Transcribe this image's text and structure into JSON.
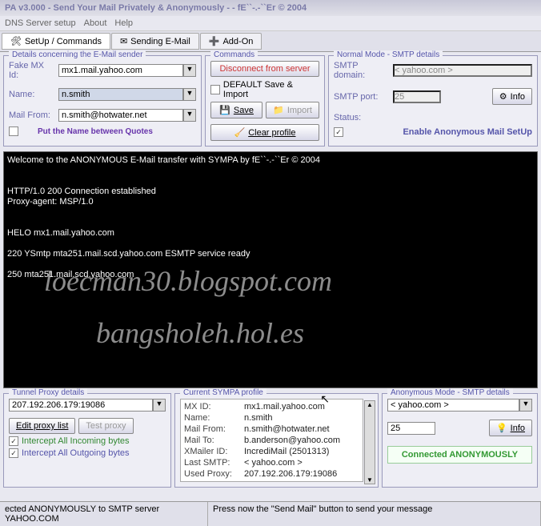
{
  "title": "PA v3.000 - Send Your Mail Privately & Anonymously -                    - fE``-.-``Er © 2004",
  "menu": {
    "dns": "DNS Server setup",
    "about": "About",
    "help": "Help"
  },
  "tabs": {
    "setup": "SetUp / Commands",
    "sending": "Sending E-Mail",
    "addon": "Add-On"
  },
  "sender": {
    "title": "Details concerning the E-Mail sender",
    "fakemx_lbl": "Fake MX  Id:",
    "fakemx": "mx1.mail.yahoo.com",
    "name_lbl": "Name:",
    "name": "n.smith",
    "from_lbl": "Mail From:",
    "from": "n.smith@hotwater.net",
    "quote": "Put the Name between Quotes"
  },
  "commands": {
    "title": "Commands",
    "disconnect": "Disconnect from server",
    "default": "DEFAULT Save & Import",
    "save": "Save",
    "import": "Import",
    "clear": "Clear profile"
  },
  "smtp": {
    "title": "Normal Mode - SMTP details",
    "domain_lbl": "SMTP domain:",
    "domain": "< yahoo.com >",
    "port_lbl": "SMTP port:",
    "port": "25",
    "info": "Info",
    "status_lbl": "Status:",
    "enable": "Enable Anonymous Mail  SetUp"
  },
  "console": [
    "Welcome to the ANONYMOUS E-Mail transfer with SYMPA  by fE``-.-``Er © 2004",
    "",
    "",
    "HTTP/1.0 200 Connection established",
    "Proxy-agent: MSP/1.0",
    "",
    "",
    "HELO mx1.mail.yahoo.com",
    "",
    "220 YSmtp mta251.mail.scd.yahoo.com ESMTP service ready",
    "",
    "250 mta251.mail.scd.yahoo.com"
  ],
  "wm1": "loecman30.blogspot.com",
  "wm2": "bangsholeh.hol.es",
  "tunnel": {
    "title": "Tunnel Proxy details",
    "proxy": "207.192.206.179:19086",
    "edit": "Edit proxy list",
    "test": "Test proxy",
    "in": "Intercept All Incoming bytes",
    "out": "Intercept All Outgoing bytes"
  },
  "profile": {
    "title": "Current SYMPA profile",
    "rows": [
      {
        "k": "MX ID:",
        "v": "mx1.mail.yahoo.com"
      },
      {
        "k": "Name:",
        "v": "n.smith"
      },
      {
        "k": "Mail From:",
        "v": "n.smith@hotwater.net"
      },
      {
        "k": "Mail To:",
        "v": "b.anderson@yahoo.com"
      },
      {
        "k": "XMailer ID:",
        "v": "IncrediMail (2501313)"
      },
      {
        "k": "Last SMTP:",
        "v": "< yahoo.com >"
      },
      {
        "k": "Used Proxy:",
        "v": "207.192.206.179:19086"
      }
    ]
  },
  "anon": {
    "title": "Anonymous Mode - SMTP details",
    "domain": "< yahoo.com >",
    "port": "25",
    "info": "Info",
    "connected": "Connected  ANONYMOUSLY"
  },
  "status": {
    "left": "ected ANONYMOUSLY to SMTP server  YAHOO.COM",
    "right": "Press now the \"Send Mail\" button to send your message"
  }
}
